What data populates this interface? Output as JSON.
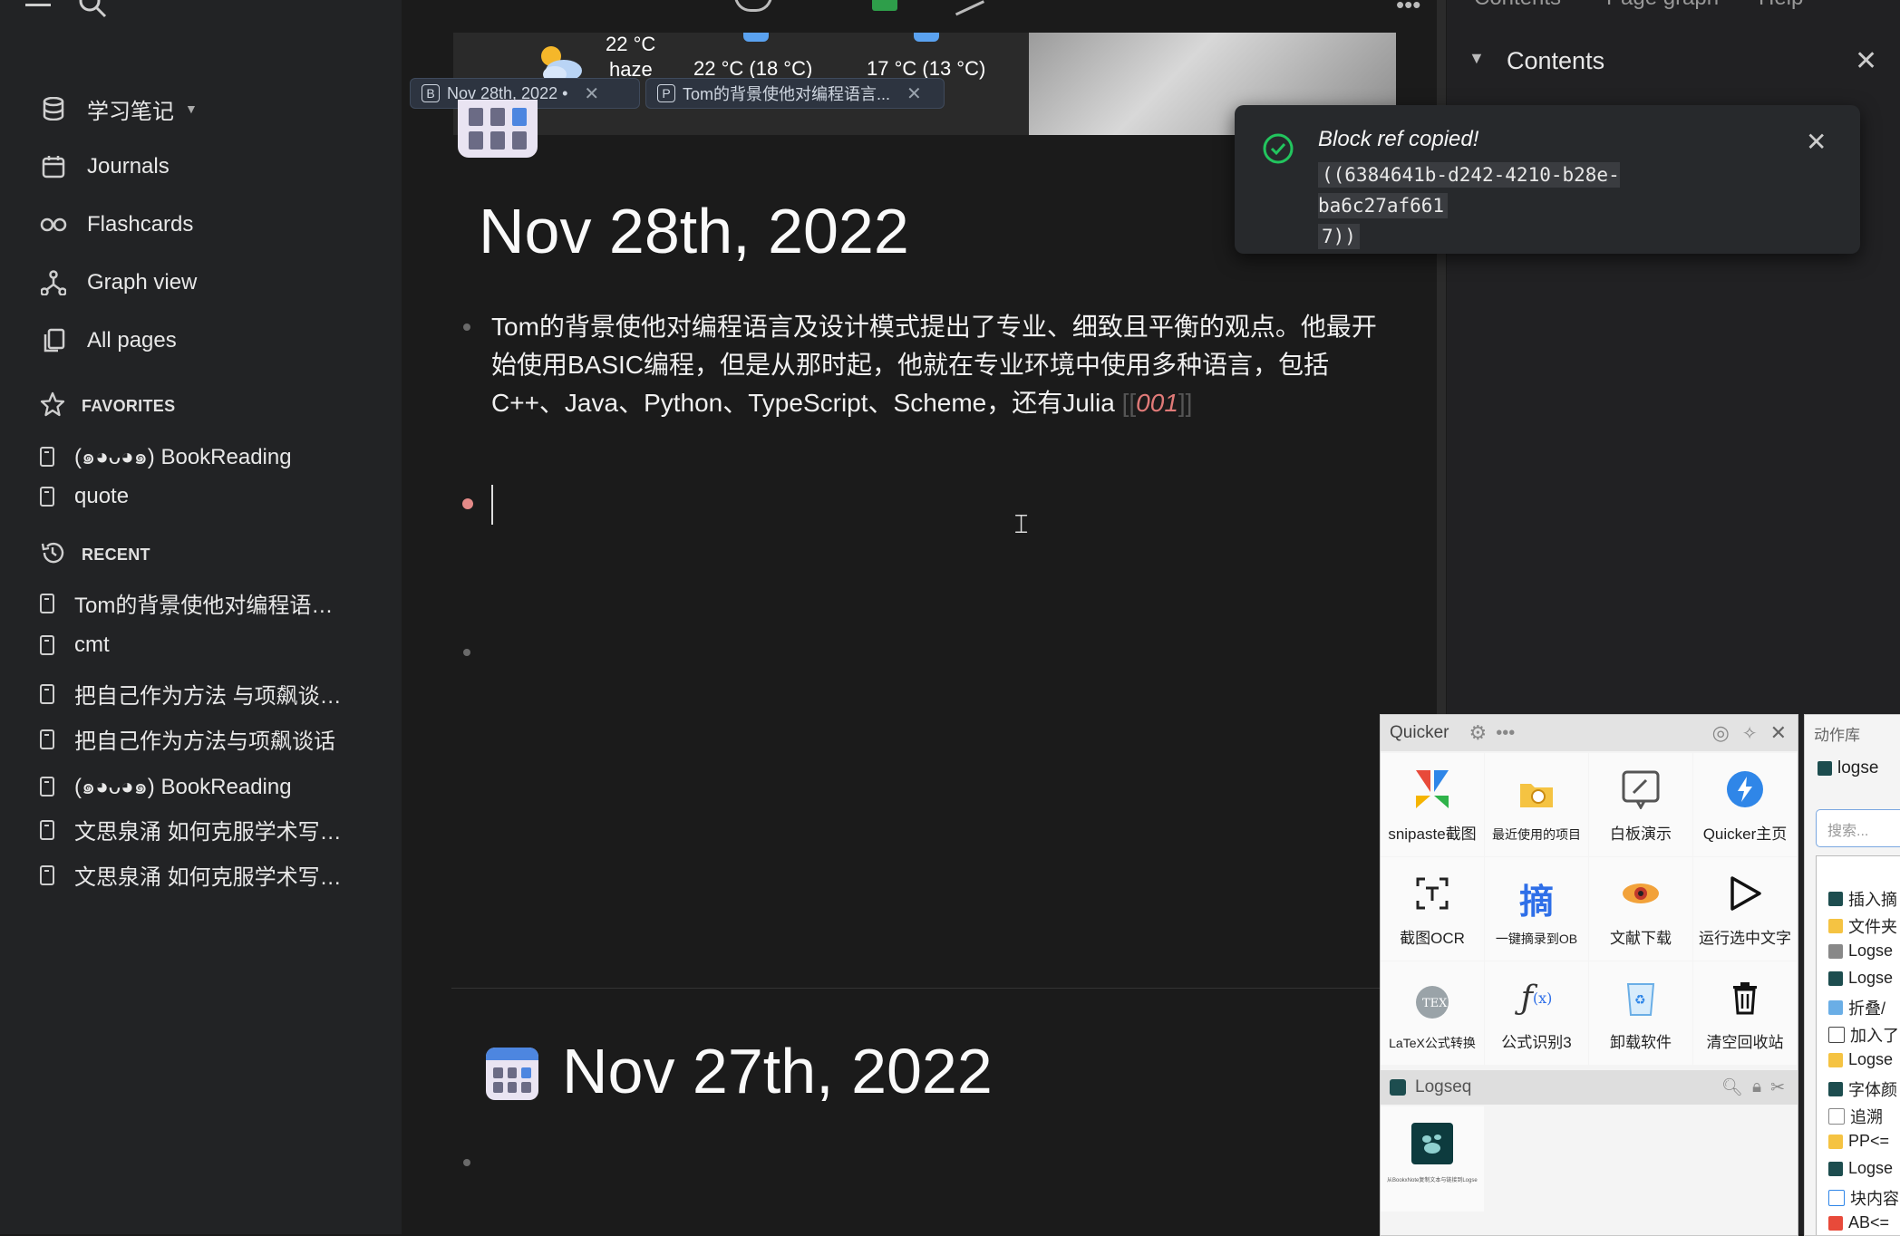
{
  "sidebar": {
    "graph_name": "学习笔记",
    "nav": [
      {
        "label": "Journals",
        "icon": "calendar-icon"
      },
      {
        "label": "Flashcards",
        "icon": "infinity-icon"
      },
      {
        "label": "Graph view",
        "icon": "graph-icon"
      },
      {
        "label": "All pages",
        "icon": "pages-icon"
      }
    ],
    "favorites_title": "FAVORITES",
    "favorites": [
      "(๑◕ᴗ◕๑) BookReading",
      "quote"
    ],
    "recent_title": "RECENT",
    "recent": [
      "Tom的背景使他对编程语…",
      "cmt",
      "把自己作为方法 与项飙谈…",
      "把自己作为方法与项飙谈话",
      "(๑◕ᴗ◕๑) BookReading",
      "文思泉涌 如何克服学术写…",
      "文思泉涌 如何克服学术写…"
    ]
  },
  "banner": {
    "temp_now": "22 °C",
    "cond_now": "haze",
    "temp_2": "22 °C (18 °C)",
    "temp_3": "17 °C (13 °C)"
  },
  "tabs": [
    {
      "letter": "B",
      "label": "Nov 28th, 2022 •"
    },
    {
      "letter": "P",
      "label": "Tom的背景使他对编程语言..."
    }
  ],
  "journal1": {
    "title": "Nov 28th, 2022",
    "block_text": "Tom的背景使他对编程语言及设计模式提出了专业、细致且平衡的观点。他最开始使用BASIC编程，但是从那时起，他就在专业环境中使用多种语言，包括C++、Java、Python、TypeScript、Scheme，还有Julia",
    "ref_open": "[[",
    "ref": "001",
    "ref_close": "]]"
  },
  "journal2": {
    "title": "Nov 27th, 2022"
  },
  "right_panel": {
    "tabs_partial": [
      "Contents",
      "Page graph",
      "Help"
    ],
    "contents_title": "Contents"
  },
  "toast": {
    "title": "Block ref copied!",
    "code_line1": "((6384641b-d242-4210-b28e-ba6c27af661",
    "code_line2": "7))"
  },
  "quicker": {
    "title": "Quicker",
    "items": [
      {
        "label": "snipaste截图"
      },
      {
        "label": "最近使用的项目"
      },
      {
        "label": "白板演示"
      },
      {
        "label": "Quicker主页"
      },
      {
        "label": "截图OCR"
      },
      {
        "label": "一键摘录到OB"
      },
      {
        "label": "文献下载"
      },
      {
        "label": "运行选中文字"
      },
      {
        "label": "LaTeX公式转换"
      },
      {
        "label": "公式识别3"
      },
      {
        "label": "卸载软件"
      },
      {
        "label": "清空回收站"
      }
    ],
    "sub_title": "Logseq",
    "sub_item_caption": "从BookxNote复制文本与链接到Logseq"
  },
  "action_library": {
    "title": "动作库",
    "tab": "logse",
    "search_placeholder": "搜索...",
    "rows": [
      "插入摘",
      "文件夹",
      "Logse",
      "Logse",
      "折叠/",
      "加入了",
      "Logse",
      "字体颜",
      "追溯",
      "PP<=",
      "Logse",
      "块内容",
      "AB<="
    ]
  }
}
